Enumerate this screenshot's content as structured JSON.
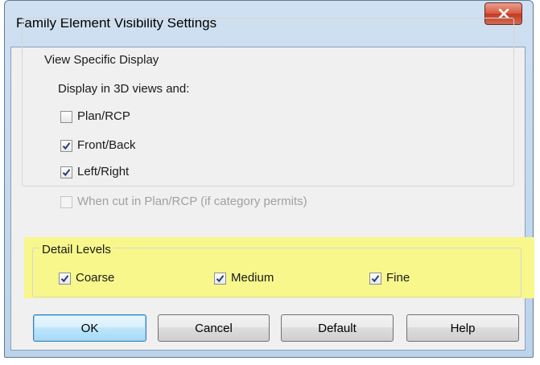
{
  "window": {
    "title": "Family Element Visibility Settings"
  },
  "view_specific_display": {
    "group_label": "View Specific Display",
    "sub_label": "Display in 3D views and:",
    "options": [
      {
        "label": "Plan/RCP",
        "checked": false,
        "enabled": true
      },
      {
        "label": "Front/Back",
        "checked": true,
        "enabled": true
      },
      {
        "label": "Left/Right",
        "checked": true,
        "enabled": true
      },
      {
        "label": "When cut in Plan/RCP (if category permits)",
        "checked": false,
        "enabled": false
      }
    ]
  },
  "detail_levels": {
    "group_label": "Detail Levels",
    "highlight_color": "#f7f78c",
    "options": [
      {
        "label": "Coarse",
        "checked": true
      },
      {
        "label": "Medium",
        "checked": true
      },
      {
        "label": "Fine",
        "checked": true
      }
    ]
  },
  "buttons": {
    "ok": "OK",
    "cancel": "Cancel",
    "default": "Default",
    "help": "Help"
  },
  "icons": {
    "close": "close-icon",
    "check": "checkmark-icon"
  },
  "colors": {
    "close_button": "#c43a22",
    "check_mark": "#1f3e7a",
    "default_button_border": "#3c7fb1"
  }
}
